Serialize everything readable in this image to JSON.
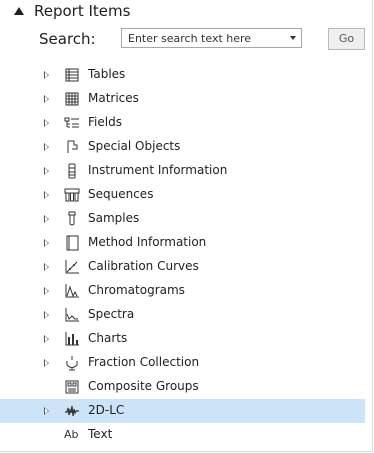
{
  "panel": {
    "title": "Report Items",
    "search_label": "Search:",
    "search_placeholder": "Enter search text here",
    "go_label": "Go"
  },
  "items": [
    {
      "label": "Tables",
      "icon": "table-icon",
      "expandable": true
    },
    {
      "label": "Matrices",
      "icon": "matrix-icon",
      "expandable": true
    },
    {
      "label": "Fields",
      "icon": "fields-icon",
      "expandable": true
    },
    {
      "label": "Special Objects",
      "icon": "special-objects-icon",
      "expandable": true
    },
    {
      "label": "Instrument Information",
      "icon": "instrument-icon",
      "expandable": true
    },
    {
      "label": "Sequences",
      "icon": "sequences-icon",
      "expandable": true
    },
    {
      "label": "Samples",
      "icon": "sample-vial-icon",
      "expandable": true
    },
    {
      "label": "Method Information",
      "icon": "method-book-icon",
      "expandable": true
    },
    {
      "label": "Calibration Curves",
      "icon": "calibration-curve-icon",
      "expandable": true
    },
    {
      "label": "Chromatograms",
      "icon": "chromatogram-icon",
      "expandable": true
    },
    {
      "label": "Spectra",
      "icon": "spectra-icon",
      "expandable": true
    },
    {
      "label": "Charts",
      "icon": "bar-chart-icon",
      "expandable": true
    },
    {
      "label": "Fraction Collection",
      "icon": "fraction-collection-icon",
      "expandable": true
    },
    {
      "label": "Composite Groups",
      "icon": "composite-group-icon",
      "expandable": false
    },
    {
      "label": "2D-LC",
      "icon": "2d-lc-icon",
      "expandable": true,
      "selected": true
    },
    {
      "label": "Text",
      "icon": "text-icon",
      "expandable": false,
      "glyph": "Ab"
    }
  ],
  "colors": {
    "selected_bg": "#cce4f7",
    "text": "#1f1f1f"
  }
}
